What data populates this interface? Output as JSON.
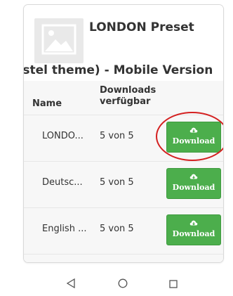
{
  "product": {
    "title_line1": "LONDON Preset",
    "title_line2": "(pastel theme) - Mobile Version",
    "thumbnail_icon": "image-placeholder-icon"
  },
  "table": {
    "headers": {
      "name": "Name",
      "downloads_line1": "Downloads",
      "downloads_line2": "verfügbar"
    },
    "rows": [
      {
        "name": "LONDO...",
        "available": "5 von 5",
        "button_label": "Download",
        "highlighted": true
      },
      {
        "name": "Deutsc...",
        "available": "5 von 5",
        "button_label": "Download",
        "highlighted": false
      },
      {
        "name": "English ...",
        "available": "5 von 5",
        "button_label": "Download",
        "highlighted": false
      }
    ],
    "button_icon": "cloud-download-icon",
    "button_color": "#4cae4c",
    "highlight_color": "#d42020"
  },
  "navbar": {
    "back_icon": "back-triangle-icon",
    "home_icon": "home-circle-icon",
    "recents_icon": "recents-square-icon"
  }
}
